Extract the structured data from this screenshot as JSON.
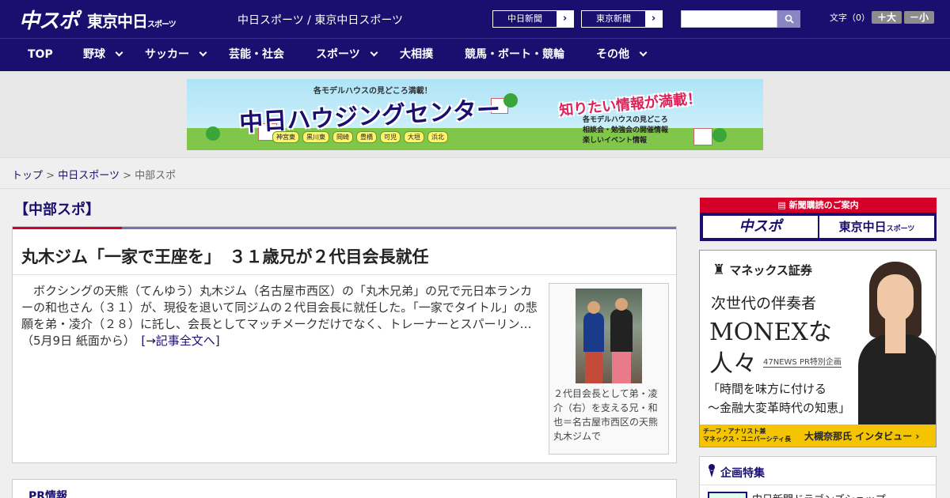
{
  "header": {
    "logo_main": "中スポ",
    "logo_sub": "東京中日",
    "logo_sub_small": "スポーツ",
    "site_name": "中日スポーツ / 東京中日スポーツ",
    "btn_chunichi": "中日新聞",
    "btn_tokyo": "東京新聞",
    "arrow": "›",
    "search_value": "",
    "moji_label": "文字（0）",
    "size_up": "＋大",
    "size_down": "－小"
  },
  "nav": {
    "items": [
      {
        "label": "TOP",
        "dropdown": false
      },
      {
        "label": "野球",
        "dropdown": true
      },
      {
        "label": "サッカー",
        "dropdown": true
      },
      {
        "label": "芸能・社会",
        "dropdown": false
      },
      {
        "label": "スポーツ",
        "dropdown": true
      },
      {
        "label": "大相撲",
        "dropdown": false
      },
      {
        "label": "競馬・ボート・競輪",
        "dropdown": false
      },
      {
        "label": "その他",
        "dropdown": true
      }
    ]
  },
  "banner": {
    "sub": "各モデルハウスの見どころ満載！",
    "title": "中日ハウジングセンター",
    "right_title": "知りたい情報が満載！",
    "info1": "各モデルハウスの見どころ",
    "info2": "相談会・勉強会の開催情報",
    "info3": "楽しいイベント情報",
    "cities": [
      "神宮東",
      "黒川東",
      "岡崎",
      "豊橋",
      "可児",
      "大垣",
      "浜北"
    ]
  },
  "breadcrumb": {
    "top": "トップ",
    "sep": ">",
    "chunichi": "中日スポーツ",
    "current": "中部スポ"
  },
  "section": {
    "title": "【中部スポ】"
  },
  "article": {
    "title": "丸木ジム「一家で王座を」　３１歳兄が２代目会長就任",
    "body": "ボクシングの天熊（てんゆう）丸木ジム（名古屋市西区）の「丸木兄弟」の兄で元日本ランカーの和也さん（３１）が、現役を退いて同ジムの２代目会長に就任した。「一家でタイトル」の悲願を弟・凌介（２８）に託し、会長としてマッチメークだけでなく、トレーナーとスパーリン…（5月9日 紙面から）",
    "more_link": "[→記事全文へ]",
    "photo_caption": "２代目会長として弟・凌介（右）を支える兄・和也＝名古屋市西区の天熊丸木ジムで"
  },
  "pr": {
    "title": "PR情報"
  },
  "sidebar": {
    "subscribe_head": "新聞購読のご案内",
    "sub_a": "中スポ",
    "sub_b": "東京中日",
    "sub_b_small": "スポーツ",
    "ad": {
      "brand": "マネックス証券",
      "line1": "次世代の伴奏者",
      "line2": "MONEXな",
      "line3": "人々",
      "pr_tag": "47NEWS PR特別企画",
      "quote1": "「時間を味方に付ける",
      "quote2": "〜金融大変革時代の知恵」",
      "bar_left1": "チーフ・アナリスト兼",
      "bar_left2": "マネックス・ユニバーシティ長",
      "bar_right": "大槻奈那氏 インタビュー ›"
    },
    "feature_title": "企画特集",
    "feature_item": "中日新聞ドラゴンズショップ"
  },
  "colors": {
    "brand_navy": "#1a0f6e",
    "accent_red": "#d4002a",
    "ad_yellow": "#f5c400"
  }
}
